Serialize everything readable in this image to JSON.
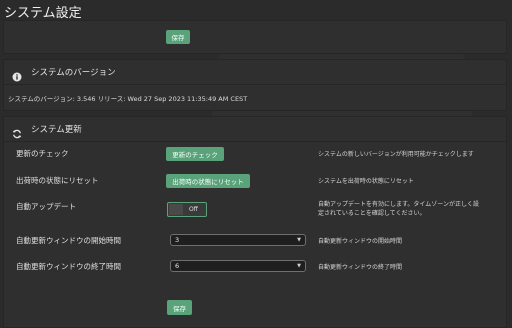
{
  "page": {
    "title": "システム設定"
  },
  "top_panel": {
    "save_label": "保存"
  },
  "version_panel": {
    "title": "システムのバージョン",
    "info": "システムのバージョン: 3.546 リリース: Wed 27 Sep 2023 11:35:49 AM CEST"
  },
  "update_panel": {
    "title": "システム更新",
    "rows": [
      {
        "label": "更新のチェック",
        "button": "更新のチェック",
        "desc": "システムの新しいバージョンが利用可能かチェックします"
      },
      {
        "label": "出荷時の状態にリセット",
        "button": "出荷時の状態にリセット",
        "desc": "システムを出荷時の状態にリセット"
      },
      {
        "label": "自動アップデート",
        "toggle_state": "Off",
        "desc_line1": "自動アップデートを有効にします。タイムゾーンが正しく設",
        "desc_line2": "定されていることを確認してください。"
      },
      {
        "label": "自動更新ウィンドウの開始時間",
        "value": "3",
        "desc": "自動更新ウィンドウの開始時間"
      },
      {
        "label": "自動更新ウィンドウの終了時間",
        "value": "6",
        "desc": "自動更新ウィンドウの終了時間"
      }
    ],
    "save_label": "保存"
  },
  "icons": {
    "info": "info-circle-icon",
    "refresh": "refresh-icon",
    "dropdown": "chevron-down-icon"
  },
  "colors": {
    "accent": "#5aa37a",
    "background": "#2b2b2b",
    "panel": "#2f2f2f"
  }
}
